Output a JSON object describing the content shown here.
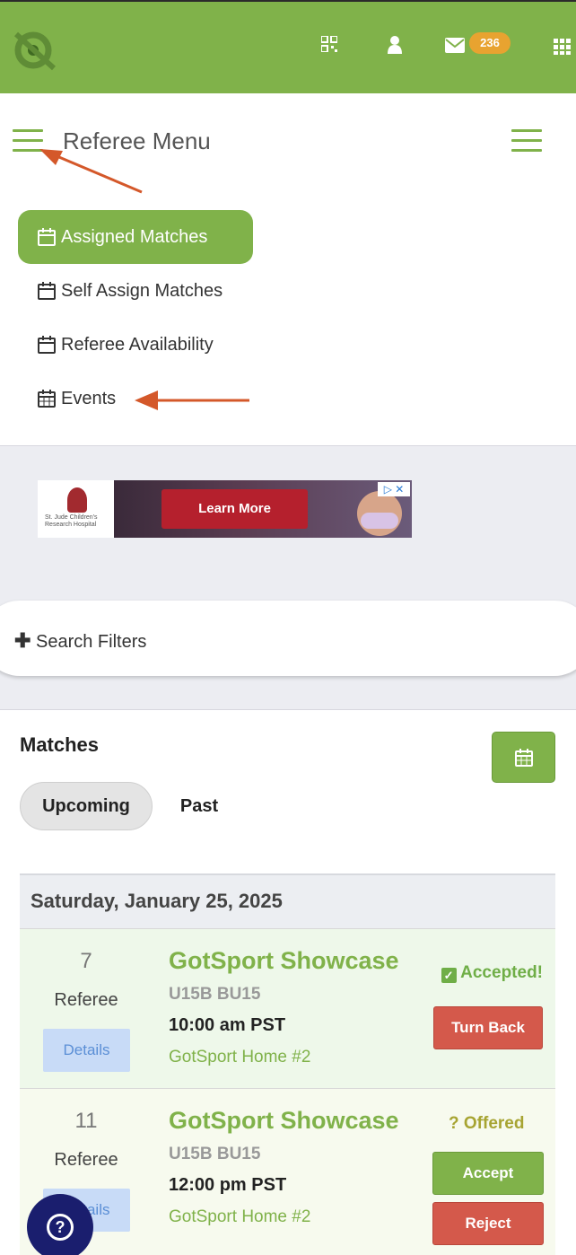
{
  "topbar": {
    "badge_count": "236",
    "icons": [
      "qr-code-icon",
      "user-icon",
      "envelope-icon",
      "grid-icon"
    ],
    "color": "#80b24a"
  },
  "referee_menu": {
    "title": "Referee Menu",
    "items": [
      {
        "label": "Assigned Matches",
        "icon": "calendar-icon",
        "active": true
      },
      {
        "label": "Self Assign Matches",
        "icon": "calendar-icon",
        "active": false
      },
      {
        "label": "Referee Availability",
        "icon": "calendar-icon",
        "active": false
      },
      {
        "label": "Events",
        "icon": "calendar-grid-icon",
        "active": false
      }
    ]
  },
  "ad": {
    "sponsor": "St. Jude Children's Research Hospital",
    "button_label": "Learn More"
  },
  "search_filters": {
    "label": "Search Filters"
  },
  "matches": {
    "title": "Matches",
    "tabs": [
      {
        "label": "Upcoming",
        "active": true
      },
      {
        "label": "Past",
        "active": false
      }
    ],
    "date_header": "Saturday, January 25, 2025",
    "rows": [
      {
        "number": "7",
        "role": "Referee",
        "details_label": "Details",
        "event": "GotSport Showcase",
        "code": "U15B BU15",
        "time": "10:00 am PST",
        "venue": "GotSport Home #2",
        "status": "Accepted!",
        "action_label": "Turn Back"
      },
      {
        "number": "11",
        "role": "Referee",
        "details_label": "Details",
        "event": "GotSport Showcase",
        "code": "U15B BU15",
        "time": "12:00 pm PST",
        "venue": "GotSport Home #2",
        "status": "? Offered",
        "accept_label": "Accept",
        "reject_label": "Reject"
      }
    ]
  },
  "colors": {
    "accent_green": "#80b24a",
    "reject_red": "#d4594b",
    "annotation_arrow": "#d4582a"
  }
}
